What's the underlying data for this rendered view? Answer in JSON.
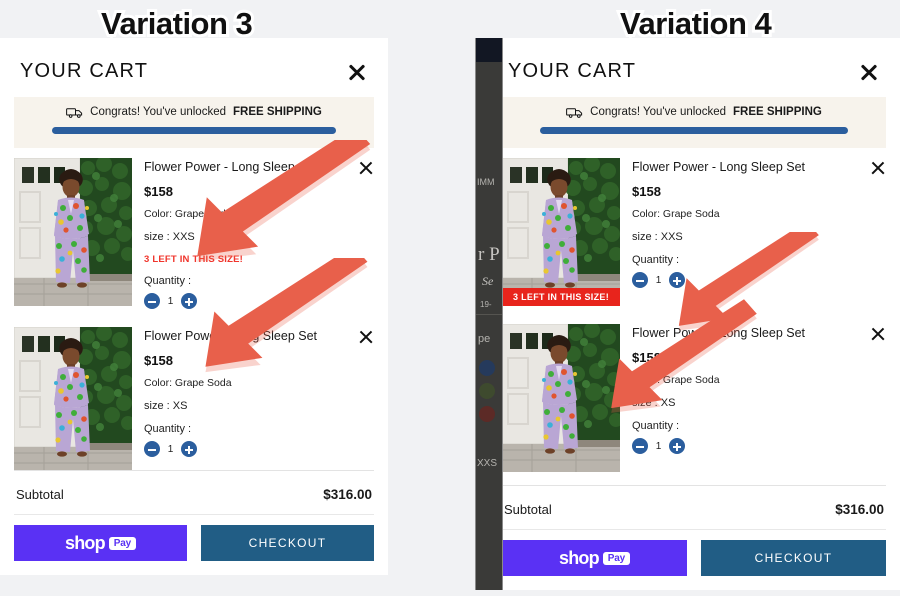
{
  "variations": [
    {
      "title": "Variation 3",
      "cart": {
        "heading": "YOUR CART",
        "close_icon": "close-icon",
        "shipping": {
          "icon": "truck-icon",
          "message": "Congrats! You've unlocked",
          "highlight": "FREE SHIPPING",
          "progress_percent": 100,
          "bar_color": "#2b5e9e",
          "banner_bg": "#f7f3ec"
        },
        "items": [
          {
            "title": "Flower Power - Long Sleep Set",
            "price": "$158",
            "color": "Color: Grape Soda",
            "size": "size : XXS",
            "stock_warning": "3 LEFT IN THIS SIZE!",
            "stock_style": "text",
            "stock_color": "#f0352c",
            "quantity_label": "Quantity :",
            "quantity": "1",
            "decrement_label": "-",
            "increment_label": "+",
            "remove_icon": "close-icon"
          },
          {
            "title": "Flower Power - Long Sleep Set",
            "price": "$158",
            "color": "Color: Grape Soda",
            "size": "size : XS",
            "stock_warning": "",
            "stock_style": "none",
            "quantity_label": "Quantity :",
            "quantity": "1",
            "decrement_label": "-",
            "increment_label": "+",
            "remove_icon": "close-icon"
          }
        ],
        "footer": {
          "subtotal_label": "Subtotal",
          "subtotal_value": "$316.00",
          "shop_pay_word": "shop",
          "shop_pay_pill": "Pay",
          "shop_pay_color": "#5a31f4",
          "checkout_label": "CHECKOUT",
          "checkout_color": "#215d85"
        }
      }
    },
    {
      "title": "Variation 4",
      "backdrop": {
        "fragments": [
          "IMM",
          "r P",
          "Se",
          "19-",
          "pe",
          "XXS"
        ]
      },
      "cart": {
        "heading": "YOUR CART",
        "close_icon": "close-icon",
        "shipping": {
          "icon": "truck-icon",
          "message": "Congrats! You've unlocked",
          "highlight": "FREE SHIPPING",
          "progress_percent": 100,
          "bar_color": "#2b5e9e",
          "banner_bg": "#f7f3ec"
        },
        "items": [
          {
            "title": "Flower Power - Long Sleep Set",
            "price": "$158",
            "color": "Color: Grape Soda",
            "size": "size : XXS",
            "stock_warning": "3 LEFT IN THIS SIZE!",
            "stock_style": "banner",
            "stock_color": "#e8241c",
            "quantity_label": "Quantity :",
            "quantity": "1",
            "decrement_label": "-",
            "increment_label": "+",
            "remove_icon": "close-icon"
          },
          {
            "title": "Flower Power - Long Sleep Set",
            "price": "$158",
            "color": "Color: Grape Soda",
            "size": "size : XS",
            "stock_warning": "",
            "stock_style": "none",
            "quantity_label": "Quantity :",
            "quantity": "1",
            "decrement_label": "-",
            "increment_label": "+",
            "remove_icon": "close-icon"
          }
        ],
        "footer": {
          "subtotal_label": "Subtotal",
          "subtotal_value": "$316.00",
          "shop_pay_word": "shop",
          "shop_pay_pill": "Pay",
          "shop_pay_color": "#5a31f4",
          "checkout_label": "CHECKOUT",
          "checkout_color": "#215d85"
        }
      }
    }
  ],
  "annotations": {
    "arrow_color": "#e8604b",
    "arrows": [
      {
        "name": "arrow-v3-stock-text",
        "points_to": "3 LEFT IN THIS SIZE!"
      },
      {
        "name": "arrow-v3-quantity",
        "points_to": "Quantity stepper"
      },
      {
        "name": "arrow-v4-stock-banner",
        "points_to": "3 LEFT IN THIS SIZE! banner"
      },
      {
        "name": "arrow-v4-quantity",
        "points_to": "Quantity stepper"
      }
    ]
  }
}
